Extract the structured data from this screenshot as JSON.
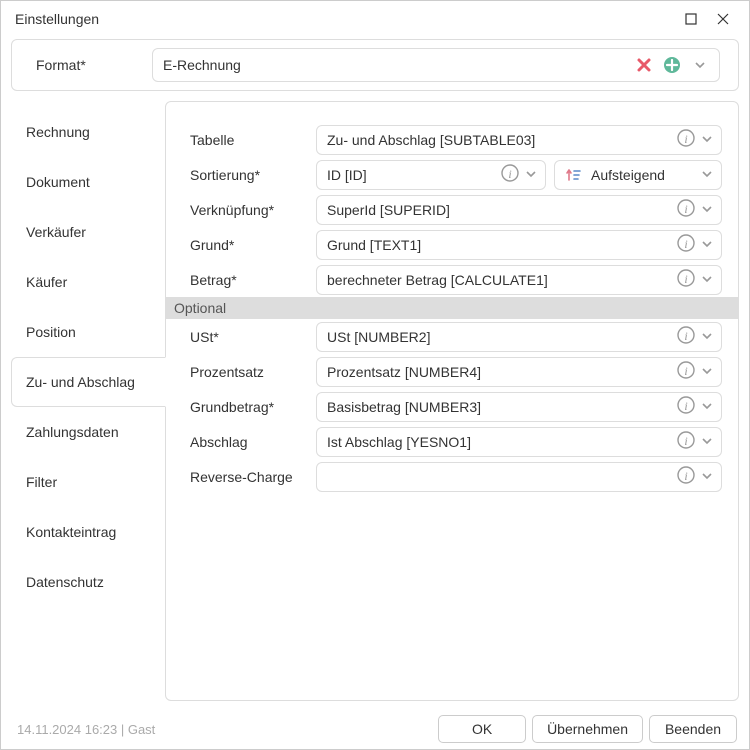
{
  "title": "Einstellungen",
  "format": {
    "label": "Format*",
    "value": "E-Rechnung"
  },
  "sidebar": {
    "items": [
      {
        "label": "Rechnung"
      },
      {
        "label": "Dokument"
      },
      {
        "label": "Verkäufer"
      },
      {
        "label": "Käufer"
      },
      {
        "label": "Position"
      },
      {
        "label": "Zu- und Abschlag"
      },
      {
        "label": "Zahlungsdaten"
      },
      {
        "label": "Filter"
      },
      {
        "label": "Kontakteintrag"
      },
      {
        "label": "Datenschutz"
      }
    ],
    "active_index": 5
  },
  "form": {
    "rows": [
      {
        "label": "Tabelle",
        "value": "Zu- und Abschlag [SUBTABLE03]",
        "info": true
      },
      {
        "label": "Sortierung*",
        "value": "ID [ID]",
        "info": true,
        "split": true,
        "order_label": "Aufsteigend"
      },
      {
        "label": "Verknüpfung*",
        "value": "SuperId [SUPERID]",
        "info": true
      },
      {
        "label": "Grund*",
        "value": "Grund [TEXT1]",
        "info": true
      },
      {
        "label": "Betrag*",
        "value": "berechneter Betrag [CALCULATE1]",
        "info": true
      }
    ],
    "section_optional": "Optional",
    "rows2": [
      {
        "label": "USt*",
        "value": "USt [NUMBER2]",
        "info": true
      },
      {
        "label": "Prozentsatz",
        "value": "Prozentsatz [NUMBER4]",
        "info": true
      },
      {
        "label": "Grundbetrag*",
        "value": "Basisbetrag [NUMBER3]",
        "info": true
      },
      {
        "label": "Abschlag",
        "value": "Ist Abschlag [YESNO1]",
        "info": true
      },
      {
        "label": "Reverse-Charge",
        "value": "",
        "info": true
      }
    ]
  },
  "footer": {
    "status": "14.11.2024 16:23 | Gast",
    "ok": "OK",
    "apply": "Übernehmen",
    "close": "Beenden"
  }
}
